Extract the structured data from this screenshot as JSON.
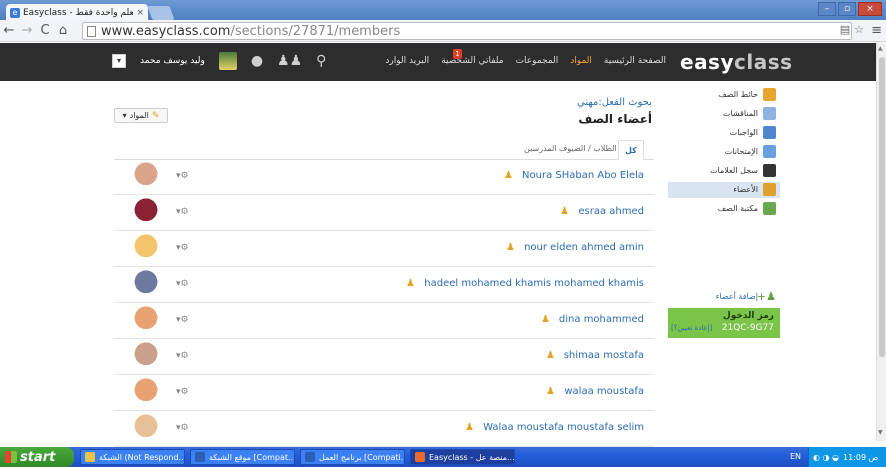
{
  "browser": {
    "tab_title": "Easyclass - منصة تعلم واحدة فقط",
    "tab_close": "×",
    "url_domain": "www.easyclass.com",
    "url_path": "/sections/27871/members",
    "window_buttons": [
      "–",
      "▫",
      "×"
    ]
  },
  "site": {
    "logo_easy": "easy",
    "logo_class": "class",
    "nav": [
      "الصفحة الرئيسية",
      "المواد",
      "المجموعات",
      "ملفاتي الشخصية",
      "البريد الوارد"
    ],
    "nav_active_index": 1,
    "inbox_count": "1",
    "username": "وليد يوسف محمد"
  },
  "main": {
    "breadcrumb": "بحوث الفعل:مهني",
    "title": "أعضاء الصف",
    "materials_button": "المواد",
    "filters": [
      "كل",
      "الطلاب / الضيوف",
      "المدرسين"
    ],
    "members": [
      {
        "name": "Noura SHaban Abo Elela",
        "color": "#d9a48a"
      },
      {
        "name": "esraa ahmed",
        "color": "#8a2333"
      },
      {
        "name": "nour elden ahmed amin",
        "color": "#f3c46b"
      },
      {
        "name": "hadeel mohamed khamis mohamed khamis",
        "color": "#6c7aa0"
      },
      {
        "name": "dina mohammed",
        "color": "#e8a271"
      },
      {
        "name": "shimaa mostafa",
        "color": "#caa08a"
      },
      {
        "name": "walaa moustafa",
        "color": "#e8a271"
      },
      {
        "name": "Walaa moustafa moustafa selim",
        "color": "#e7c095"
      }
    ]
  },
  "sidebar": {
    "items": [
      {
        "label": "حائط الصف",
        "color": "#e8a530"
      },
      {
        "label": "المناقشات",
        "color": "#8fb3e0"
      },
      {
        "label": "الواجبات",
        "color": "#4f86cf"
      },
      {
        "label": "الإمتحانات",
        "color": "#6aa0e0"
      },
      {
        "label": "سجل العلامات",
        "color": "#333333"
      },
      {
        "label": "الأعضاء",
        "color": "#e0a030"
      },
      {
        "label": "مكتبة الصف",
        "color": "#6aa84f"
      }
    ],
    "active_index": 5,
    "add_member": "إضافة أعضاء",
    "join_code_label": "رمز الدخول",
    "join_code": "21QC-9G77",
    "join_code_reset": "[إعادة تعيين؟]"
  },
  "taskbar": {
    "start": "start",
    "tasks": [
      {
        "label": "الشبكة (Not Respond...",
        "color": "#e8c44a"
      },
      {
        "label": "موقع الشبكة [Compat...",
        "color": "#2b5fb5"
      },
      {
        "label": "برنامج العمل [Compati...",
        "color": "#2b5fb5"
      },
      {
        "label": "Easyclass - منصة عل...",
        "color": "#e86a2c"
      }
    ],
    "lang": "EN",
    "time": "11:09 ص"
  }
}
